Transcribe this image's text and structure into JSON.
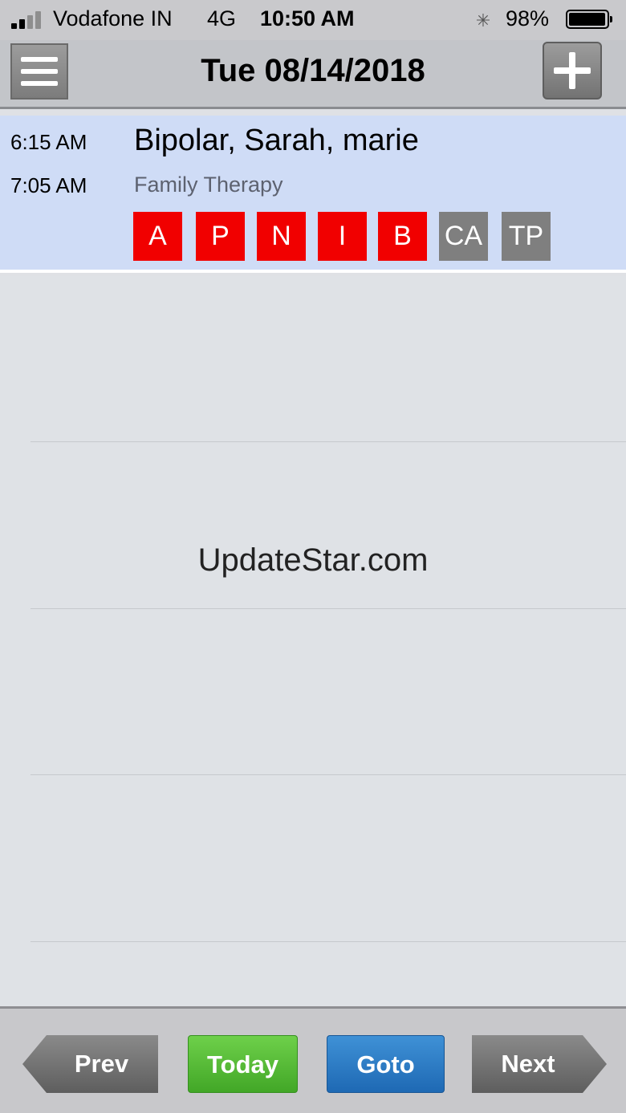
{
  "status_bar": {
    "carrier": "Vodafone IN",
    "network": "4G",
    "time": "10:50 AM",
    "battery_percent": "98%"
  },
  "header": {
    "title": "Tue 08/14/2018",
    "menu_icon": "hamburger-menu-icon",
    "add_icon": "plus-icon"
  },
  "appointment": {
    "start_time": "6:15 AM",
    "end_time": "7:05 AM",
    "patient_name": "Bipolar, Sarah, marie",
    "session_type": "Family Therapy",
    "badges": [
      {
        "label": "A",
        "color": "#f10000"
      },
      {
        "label": "P",
        "color": "#f10000"
      },
      {
        "label": "N",
        "color": "#f10000"
      },
      {
        "label": "I",
        "color": "#f10000"
      },
      {
        "label": "B",
        "color": "#f10000"
      },
      {
        "label": "CA",
        "color": "#7f7f7f"
      },
      {
        "label": "TP",
        "color": "#7f7f7f"
      }
    ]
  },
  "watermark": "UpdateStar.com",
  "footer": {
    "prev_label": "Prev",
    "today_label": "Today",
    "goto_label": "Goto",
    "next_label": "Next"
  }
}
